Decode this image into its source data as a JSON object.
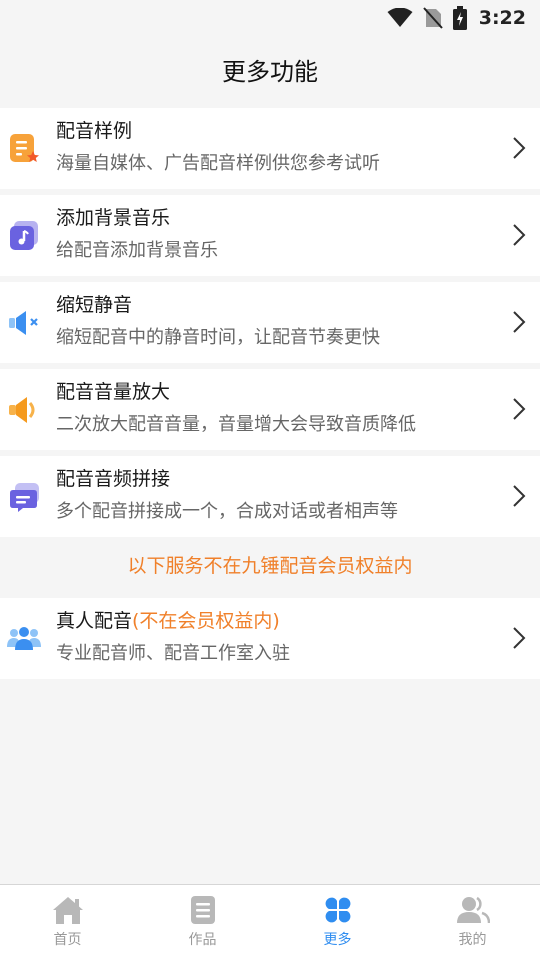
{
  "status_bar": {
    "time": "3:22"
  },
  "header": {
    "title": "更多功能"
  },
  "items": [
    {
      "title": "配音样例",
      "desc": "海量自媒体、广告配音样例供您参考试听",
      "icon": "sample-doc-icon"
    },
    {
      "title": "添加背景音乐",
      "desc": "给配音添加背景音乐",
      "icon": "music-note-icon"
    },
    {
      "title": "缩短静音",
      "desc": "缩短配音中的静音时间，让配音节奏更快",
      "icon": "speaker-mute-icon"
    },
    {
      "title": "配音音量放大",
      "desc": "二次放大配音音量，音量增大会导致音质降低",
      "icon": "speaker-loud-icon"
    },
    {
      "title": "配音音频拼接",
      "desc": "多个配音拼接成一个，合成对话或者相声等",
      "icon": "chat-merge-icon"
    }
  ],
  "notice": "以下服务不在九锤配音会员权益内",
  "human_item": {
    "title": "真人配音",
    "tag": "(不在会员权益内)",
    "desc": "专业配音师、配音工作室入驻",
    "icon": "people-group-icon"
  },
  "nav": {
    "items": [
      {
        "label": "首页",
        "icon": "home-icon",
        "active": false
      },
      {
        "label": "作品",
        "icon": "works-icon",
        "active": false
      },
      {
        "label": "更多",
        "icon": "more-grid-icon",
        "active": true
      },
      {
        "label": "我的",
        "icon": "profile-icon",
        "active": false
      }
    ]
  },
  "colors": {
    "accent": "#2f8df0",
    "warning": "#f0802a",
    "background": "#f5f5f5"
  }
}
